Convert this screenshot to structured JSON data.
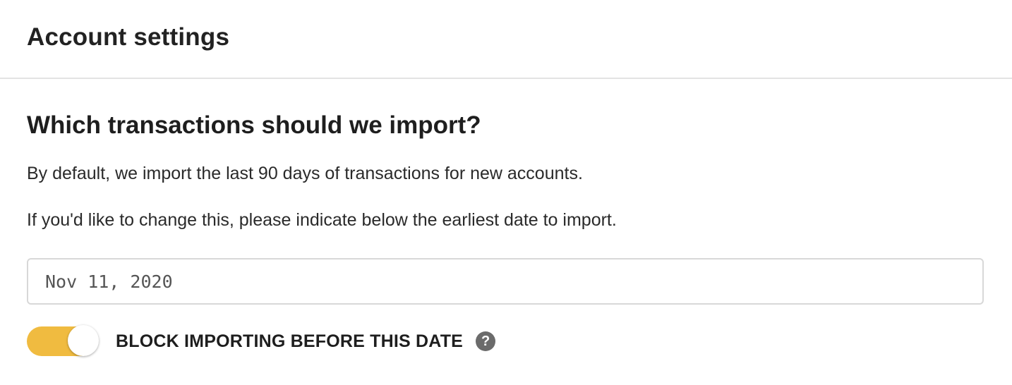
{
  "header": {
    "title": "Account settings"
  },
  "import": {
    "title": "Which transactions should we import?",
    "description_1": "By default, we import the last 90 days of transactions for new accounts.",
    "description_2": "If you'd like to change this, please indicate below the earliest date to import.",
    "date_value": "Nov 11, 2020",
    "toggle": {
      "label": "BLOCK IMPORTING BEFORE THIS DATE",
      "on": true,
      "color": "#f0bb40"
    },
    "help_icon": {
      "name": "question-circle-icon",
      "glyph": "?"
    }
  }
}
